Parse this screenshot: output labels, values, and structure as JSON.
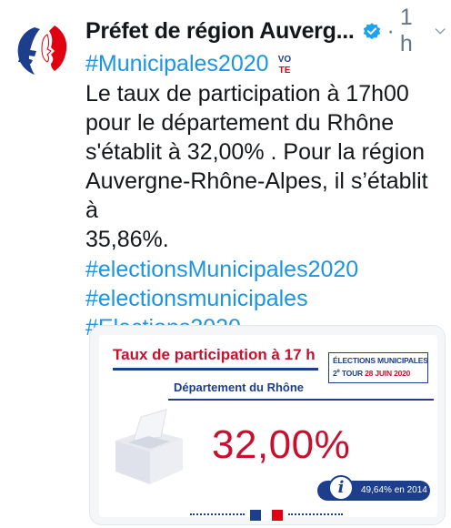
{
  "tweet": {
    "author": "Préfet de région Auverg...",
    "verified_icon": "verified-badge-icon",
    "separator": "·",
    "time": "1 h",
    "menu_icon": "chevron-down-icon",
    "hashtag_first": "#Municipales2020",
    "hashtag_emoji_icon": "vote-emoji-icon",
    "text_lines": [
      "Le taux de participation à 17h00",
      "pour le département du Rhône",
      "s'établit à 32,00% . Pour la région",
      "Auvergne-Rhône-Alpes, il s’établit à",
      "35,86%."
    ],
    "tags": [
      "#electionsMunicipales2020",
      "#electionsmunicipales",
      "#Elections2020"
    ],
    "vote_emoji_text": "VOTE"
  },
  "card": {
    "title": "Taux de participation à 17 h",
    "election_line1": "ÉLECTIONS MUNICIPALES",
    "election_line2_prefix": "2",
    "election_line2_sup": "e",
    "election_line2_mid": " TOUR ",
    "election_line2_date": "28 JUIN 2020",
    "department": "Département du Rhône",
    "rate": "32,00%",
    "info_icon_text": "i",
    "comparison": "49,64% en 2014",
    "colors": {
      "red": "#c8102e",
      "blue": "#1d3e8c",
      "link": "#1b95e0"
    }
  }
}
